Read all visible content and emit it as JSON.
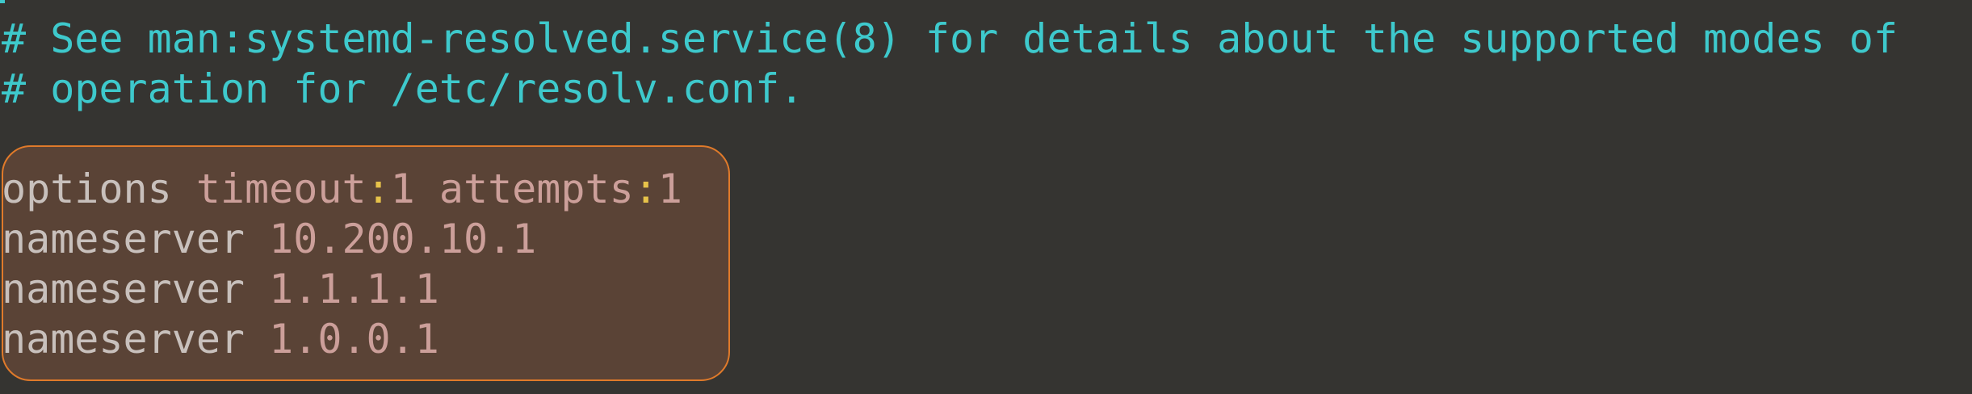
{
  "editor": {
    "comment_lines": [
      "# See man:systemd-resolved.service(8) for details about the supported modes of",
      "# operation for /etc/resolv.conf."
    ],
    "options_line": {
      "keyword": "options",
      "opt1_name": "timeout",
      "opt1_value": "1",
      "opt2_name": "attempts",
      "opt2_value": "1",
      "colon": ":"
    },
    "nameservers": [
      {
        "keyword": "nameserver",
        "address": "10.200.10.1"
      },
      {
        "keyword": "nameserver",
        "address": "1.1.1.1"
      },
      {
        "keyword": "nameserver",
        "address": "1.0.0.1"
      }
    ]
  },
  "colors": {
    "background": "#353431",
    "comment": "#3ec9cc",
    "keyword": "#c8c0bc",
    "value": "#cc9f9a",
    "colon": "#e7c34a",
    "highlight_border": "#e07a2a",
    "highlight_fill": "#5a4336"
  }
}
